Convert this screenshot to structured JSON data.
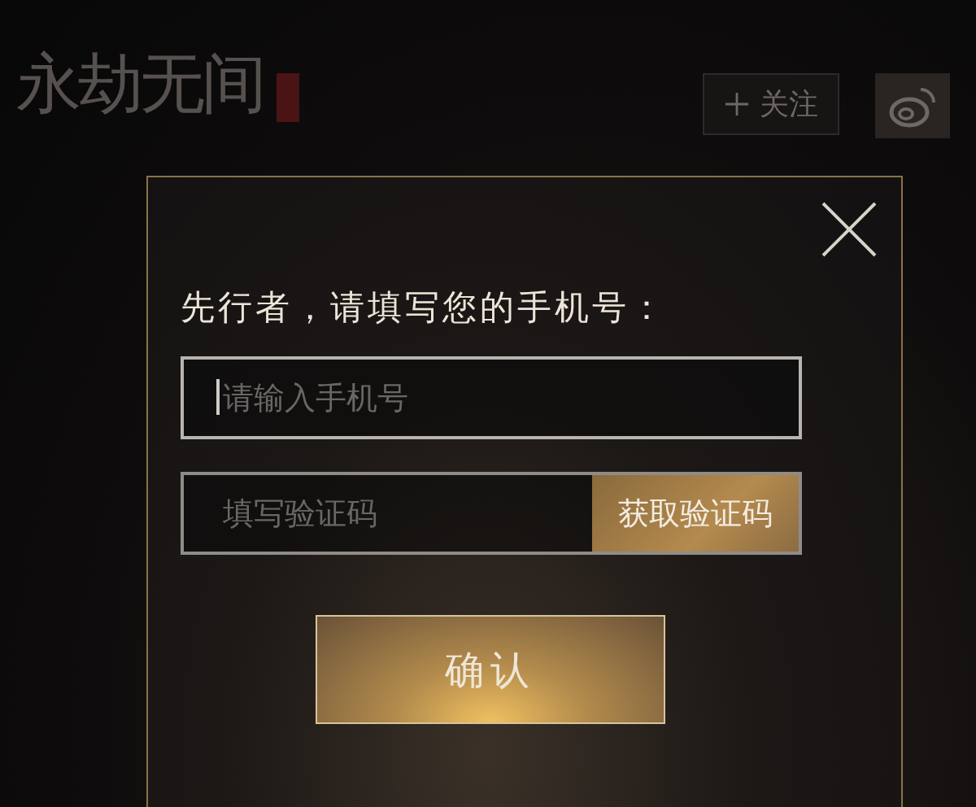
{
  "header": {
    "logo": "永劫无间",
    "follow_button": "关注"
  },
  "dialog": {
    "prompt": "先行者，请填写您的手机号：",
    "phone_field": {
      "placeholder": "请输入手机号",
      "focused": true
    },
    "code_field": {
      "placeholder": "填写验证码"
    },
    "code_button": "获取验证码",
    "confirm_button": "确认"
  }
}
